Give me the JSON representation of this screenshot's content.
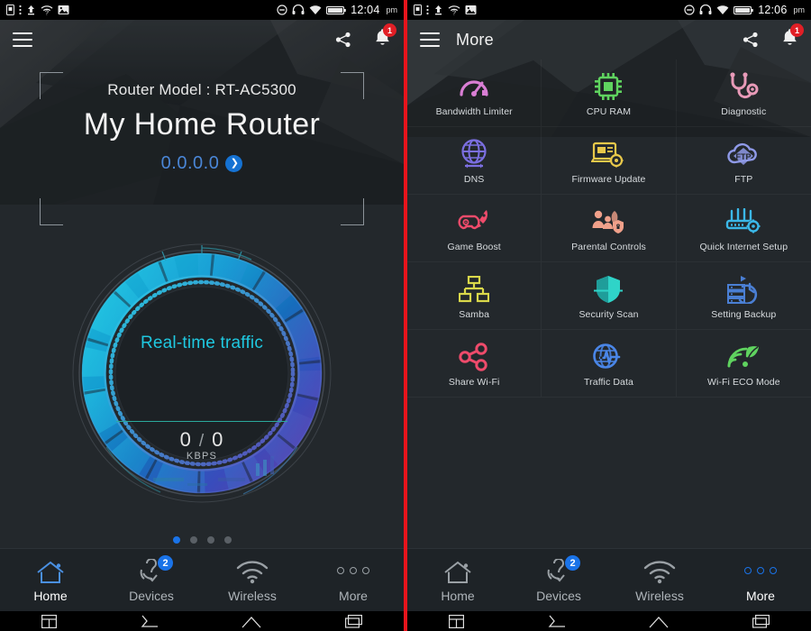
{
  "left": {
    "status_bar": {
      "icons": [
        "sim-card-icon",
        "more-vert-icon",
        "upload-icon",
        "wifi-question-icon",
        "image-icon"
      ],
      "right_icons": [
        "do-not-disturb-icon",
        "headset-icon",
        "wifi-icon",
        "battery-full-icon"
      ],
      "time": "12:04",
      "ampm": "pm"
    },
    "header": {
      "menu_icon": "hamburger-icon",
      "title": "",
      "share_icon": "share-icon",
      "bell_icon": "bell-icon",
      "notification_count": "1"
    },
    "hero": {
      "model_label": "Router Model : RT-AC5300",
      "router_name": "My Home Router",
      "ip_address": "0.0.0.0",
      "ip_chevron": "chevron-right-icon"
    },
    "gauge": {
      "title": "Real-time traffic",
      "upload": "0",
      "separator": "/",
      "download": "0",
      "unit": "KBPS",
      "accent_color": "#1fc8e0",
      "ring_colors": [
        "#1fb9e0",
        "#1573c9",
        "#3b4fc8",
        "#6a3fb0"
      ]
    },
    "page_dots": {
      "total": 4,
      "active_index": 0,
      "active_color": "#1a73e8"
    },
    "bottom_nav": {
      "active_index": 0,
      "items": [
        {
          "label": "Home",
          "icon": "home-icon",
          "badge": ""
        },
        {
          "label": "Devices",
          "icon": "devices-icon",
          "badge": "2"
        },
        {
          "label": "Wireless",
          "icon": "wifi-icon",
          "badge": ""
        },
        {
          "label": "More",
          "icon": "more-dots-icon",
          "badge": ""
        }
      ]
    }
  },
  "right": {
    "status_bar": {
      "icons": [
        "sim-card-icon",
        "more-vert-icon",
        "upload-icon",
        "wifi-question-icon",
        "image-icon"
      ],
      "right_icons": [
        "do-not-disturb-icon",
        "headset-icon",
        "wifi-icon",
        "battery-full-icon"
      ],
      "time": "12:06",
      "ampm": "pm"
    },
    "header": {
      "menu_icon": "hamburger-icon",
      "title": "More",
      "share_icon": "share-icon",
      "bell_icon": "bell-icon",
      "notification_count": "1"
    },
    "menu_items": [
      {
        "label": "Bandwidth Limiter",
        "icon": "gauge-icon",
        "color": "#d97ed4"
      },
      {
        "label": "CPU RAM",
        "icon": "cpu-chip-icon",
        "color": "#5fd35f"
      },
      {
        "label": "Diagnostic",
        "icon": "stethoscope-icon",
        "color": "#e89ab8"
      },
      {
        "label": "DNS",
        "icon": "globe-icon",
        "color": "#7b6fe0"
      },
      {
        "label": "Firmware Update",
        "icon": "laptop-gear-icon",
        "color": "#e8c84a"
      },
      {
        "label": "FTP",
        "icon": "ftp-cloud-icon",
        "color": "#8f9ae8"
      },
      {
        "label": "Game Boost",
        "icon": "gamepad-rocket-icon",
        "color": "#ef4b6b"
      },
      {
        "label": "Parental Controls",
        "icon": "family-shield-icon",
        "color": "#f0a08a"
      },
      {
        "label": "Quick Internet Setup",
        "icon": "router-gear-icon",
        "color": "#3bb8e8"
      },
      {
        "label": "Samba",
        "icon": "network-tree-icon",
        "color": "#d9d84a"
      },
      {
        "label": "Security Scan",
        "icon": "shield-icon",
        "color": "#2fd4c8"
      },
      {
        "label": "Setting Backup",
        "icon": "server-clock-icon",
        "color": "#4a7fd4"
      },
      {
        "label": "Share Wi-Fi",
        "icon": "share-nodes-icon",
        "color": "#ef4b6b"
      },
      {
        "label": "Traffic Data",
        "icon": "traffic-pulse-icon",
        "color": "#4a86e8"
      },
      {
        "label": "Wi-Fi ECO Mode",
        "icon": "wifi-leaf-icon",
        "color": "#5fd35f"
      }
    ],
    "bottom_nav": {
      "active_index": 3,
      "items": [
        {
          "label": "Home",
          "icon": "home-icon",
          "badge": ""
        },
        {
          "label": "Devices",
          "icon": "devices-icon",
          "badge": "2"
        },
        {
          "label": "Wireless",
          "icon": "wifi-icon",
          "badge": ""
        },
        {
          "label": "More",
          "icon": "more-dots-icon",
          "badge": ""
        }
      ]
    }
  },
  "theme": {
    "divider_color": "#e8141c",
    "background": "#23282c",
    "nav_background": "#1e2327"
  }
}
